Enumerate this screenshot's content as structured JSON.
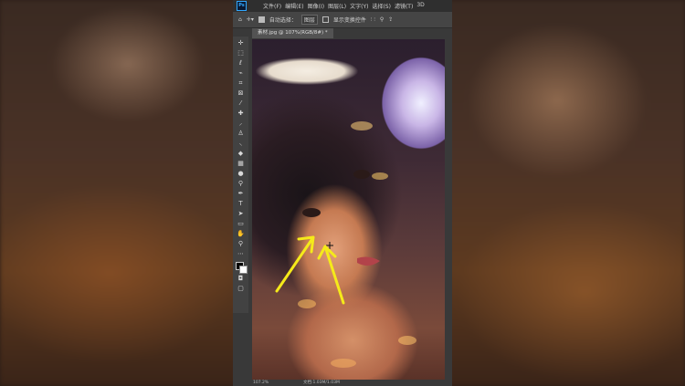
{
  "app": {
    "logo_text": "Ps"
  },
  "menu": [
    "文件(F)",
    "编辑(E)",
    "图像(I)",
    "图层(L)",
    "文字(Y)",
    "选择(S)",
    "滤镜(T)",
    "3D"
  ],
  "options_bar": {
    "auto_select_label": "自动选择：",
    "auto_select_target": "图层",
    "transform_controls_label": "显示变换控件"
  },
  "document_tab": {
    "title": "素材.jpg @ 107%(RGB/8#) *"
  },
  "status_bar": {
    "zoom": "107.2%",
    "doc_size": "文档:1.03M/1.03M"
  },
  "tools": [
    {
      "icon": "move-icon",
      "glyph": "✛"
    },
    {
      "icon": "marquee-icon",
      "glyph": "⬚"
    },
    {
      "icon": "lasso-icon",
      "glyph": "ℓ"
    },
    {
      "icon": "quick-select-icon",
      "glyph": "⌁"
    },
    {
      "icon": "crop-icon",
      "glyph": "⌗"
    },
    {
      "icon": "frame-icon",
      "glyph": "⊠"
    },
    {
      "icon": "eyedropper-icon",
      "glyph": "⁄"
    },
    {
      "icon": "healing-brush-icon",
      "glyph": "✚"
    },
    {
      "icon": "brush-icon",
      "glyph": "⸝"
    },
    {
      "icon": "clone-stamp-icon",
      "glyph": "♙"
    },
    {
      "icon": "history-brush-icon",
      "glyph": "⸜"
    },
    {
      "icon": "eraser-icon",
      "glyph": "◆"
    },
    {
      "icon": "gradient-icon",
      "glyph": "▦"
    },
    {
      "icon": "blur-icon",
      "glyph": "●"
    },
    {
      "icon": "dodge-icon",
      "glyph": "⚲"
    },
    {
      "icon": "pen-icon",
      "glyph": "✒"
    },
    {
      "icon": "type-icon",
      "glyph": "T"
    },
    {
      "icon": "path-select-icon",
      "glyph": "➤"
    },
    {
      "icon": "shape-icon",
      "glyph": "▭"
    },
    {
      "icon": "hand-icon",
      "glyph": "✋"
    },
    {
      "icon": "zoom-icon",
      "glyph": "⚲"
    },
    {
      "icon": "more-tools-icon",
      "glyph": "⋯"
    }
  ],
  "annotation": {
    "arrow_color": "#f5ea1a"
  }
}
